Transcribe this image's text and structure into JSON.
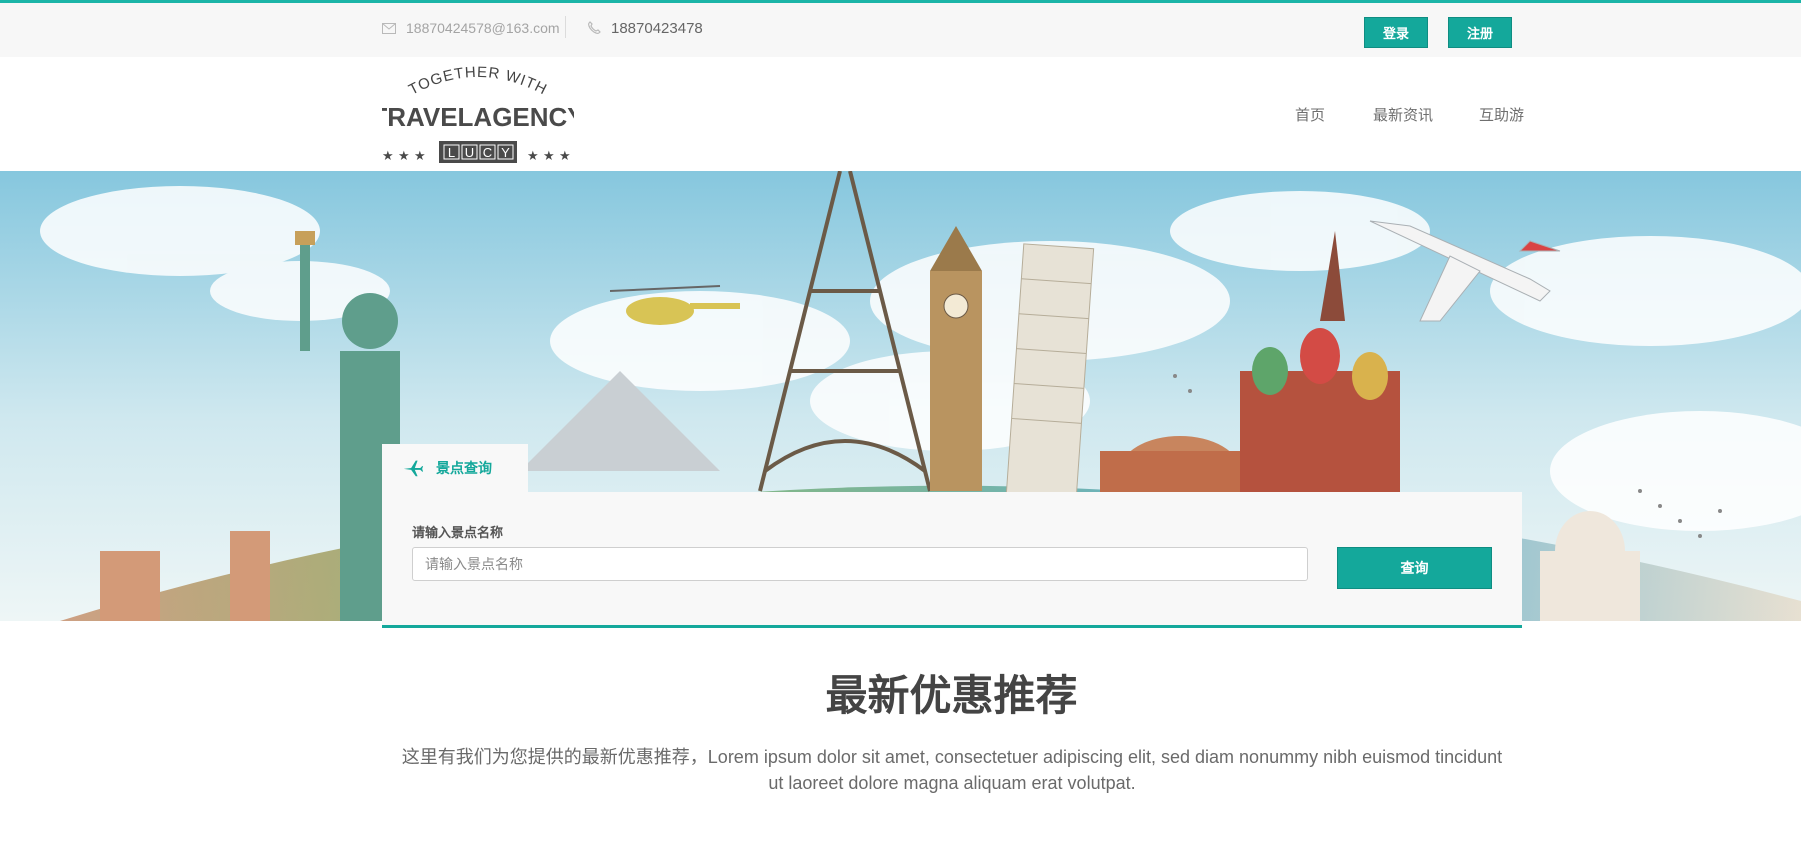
{
  "topbar": {
    "email": "18870424578@163.com",
    "phone": "18870423478",
    "login_label": "登录",
    "register_label": "注册"
  },
  "logo": {
    "arc_text": "TOGETHER WITH",
    "main_text": "TRAVELAGENCY",
    "badge_letters": [
      "L",
      "U",
      "C",
      "Y"
    ]
  },
  "nav": {
    "items": [
      "首页",
      "最新资讯",
      "互助游"
    ]
  },
  "search": {
    "tab_label": "景点查询",
    "field_label": "请输入景点名称",
    "placeholder": "请输入景点名称",
    "button_label": "查询"
  },
  "promo": {
    "title": "最新优惠推荐",
    "description": "这里有我们为您提供的最新优惠推荐，Lorem ipsum dolor sit amet, consectetuer adipiscing elit, sed diam nonummy nibh euismod tincidunt ut laoreet dolore magna aliquam erat volutpat."
  },
  "colors": {
    "accent": "#14a89b",
    "topbar_bg": "#f7f7f7",
    "panel_bg": "#f8f8f8"
  }
}
